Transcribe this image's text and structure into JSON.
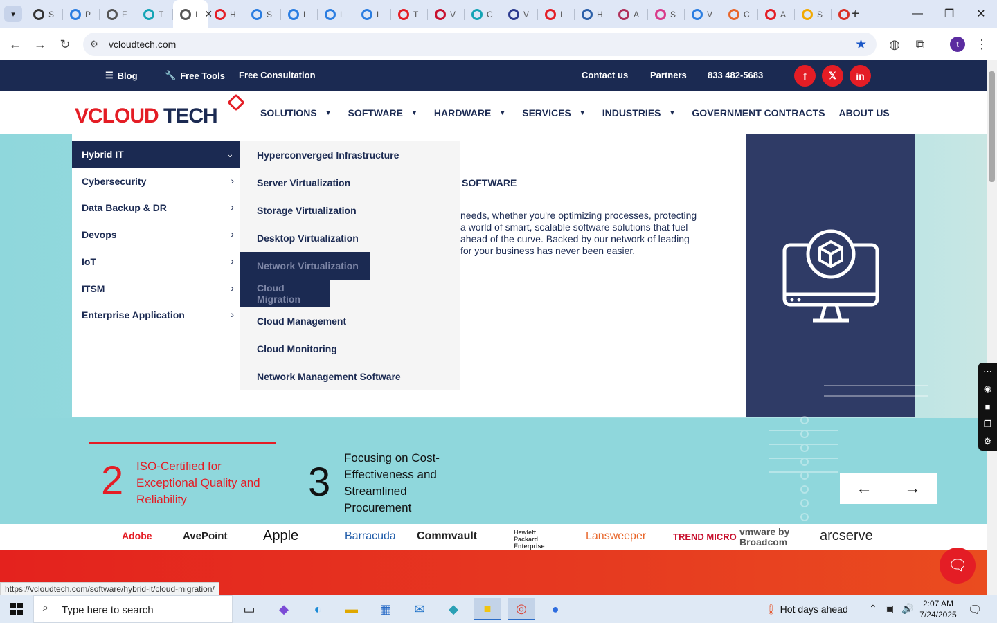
{
  "browser": {
    "tabs": [
      {
        "label": "S",
        "color": "#333333"
      },
      {
        "label": "P",
        "color": "#2a7de1"
      },
      {
        "label": "F",
        "color": "#555555"
      },
      {
        "label": "T",
        "color": "#14a4b5"
      },
      {
        "label": "I",
        "color": "#555555",
        "active": true
      },
      {
        "label": "H",
        "color": "#e41d25"
      },
      {
        "label": "S",
        "color": "#2a7de1"
      },
      {
        "label": "L",
        "color": "#2a7de1"
      },
      {
        "label": "L",
        "color": "#2a7de1"
      },
      {
        "label": "L",
        "color": "#2a7de1"
      },
      {
        "label": "T",
        "color": "#e41d25"
      },
      {
        "label": "V",
        "color": "#c8102e"
      },
      {
        "label": "C",
        "color": "#14a4b5"
      },
      {
        "label": "V",
        "color": "#2b3a8f"
      },
      {
        "label": "I",
        "color": "#e41d25"
      },
      {
        "label": "H",
        "color": "#2b5fa8"
      },
      {
        "label": "A",
        "color": "#b0305a"
      },
      {
        "label": "S",
        "color": "#d93a8a"
      },
      {
        "label": "V",
        "color": "#2a7de1"
      },
      {
        "label": "C",
        "color": "#e8662a"
      },
      {
        "label": "A",
        "color": "#e41d25"
      },
      {
        "label": "S",
        "color": "#f2a900"
      },
      {
        "label": "I",
        "color": "#d93025"
      }
    ],
    "active_tab_close": "✕",
    "url": "vcloudtech.com",
    "avatar_letter": "t",
    "status_url": "https://vcloudtech.com/software/hybrid-it/cloud-migration/"
  },
  "site": {
    "topbar": {
      "blog": "Blog",
      "free_tools": "Free Tools",
      "free_consultation": "Free Consultation",
      "contact": "Contact us",
      "partners": "Partners",
      "phone": "833 482-5683",
      "social": [
        "f",
        "𝕏",
        "in"
      ]
    },
    "logo": {
      "v": "V",
      "cloud": "CLOUD",
      "tech": "TECH"
    },
    "nav": [
      {
        "label": "SOLUTIONS",
        "caret": true
      },
      {
        "label": "SOFTWARE",
        "caret": true
      },
      {
        "label": "HARDWARE",
        "caret": true
      },
      {
        "label": "SERVICES",
        "caret": true
      },
      {
        "label": "INDUSTRIES",
        "caret": true
      },
      {
        "label": "GOVERNMENT CONTRACTS",
        "caret": false
      },
      {
        "label": "ABOUT US",
        "caret": false
      }
    ],
    "menu_categories": [
      {
        "label": "Hybrid IT",
        "active": true
      },
      {
        "label": "Cybersecurity"
      },
      {
        "label": "Data Backup & DR"
      },
      {
        "label": "Devops"
      },
      {
        "label": "IoT"
      },
      {
        "label": "ITSM"
      },
      {
        "label": "Enterprise Application"
      }
    ],
    "menu_items": [
      {
        "label": "Hyperconverged Infrastructure"
      },
      {
        "label": "Server Virtualization"
      },
      {
        "label": "Storage Virtualization"
      },
      {
        "label": "Desktop Virtualization"
      },
      {
        "label": "Network Virtualization",
        "highlight": true
      },
      {
        "label": "Cloud Migration",
        "highlight": true
      },
      {
        "label": "Cloud Management"
      },
      {
        "label": "Cloud Monitoring"
      },
      {
        "label": "Network Management Software"
      }
    ],
    "hero": {
      "title": "SOFTWARE",
      "text": "needs, whether you're optimizing processes, protecting\n a world of smart, scalable software solutions that fuel\nahead of the curve. Backed by our network of leading\nfor your business has never been easier."
    },
    "stats": [
      {
        "number": "2",
        "text": "ISO-Certified for\nExceptional Quality and\nReliability",
        "color": "#e41d25"
      },
      {
        "number": "3",
        "text": "Focusing on Cost-\nEffectiveness and\nStreamlined\nProcurement",
        "color": "#111111"
      }
    ],
    "arrows": {
      "prev": "←",
      "next": "→"
    },
    "brands": [
      "Adobe",
      "AvePoint",
      "Apple",
      "Barracuda",
      "Commvault",
      "Hewlett Packard Enterprise",
      "Lansweeper",
      "TREND MICRO",
      "vmware by Broadcom",
      "arcserve"
    ]
  },
  "taskbar": {
    "search_placeholder": "Type here to search",
    "weather": "Hot days ahead",
    "time": "2:07 AM",
    "date": "7/24/2025"
  }
}
